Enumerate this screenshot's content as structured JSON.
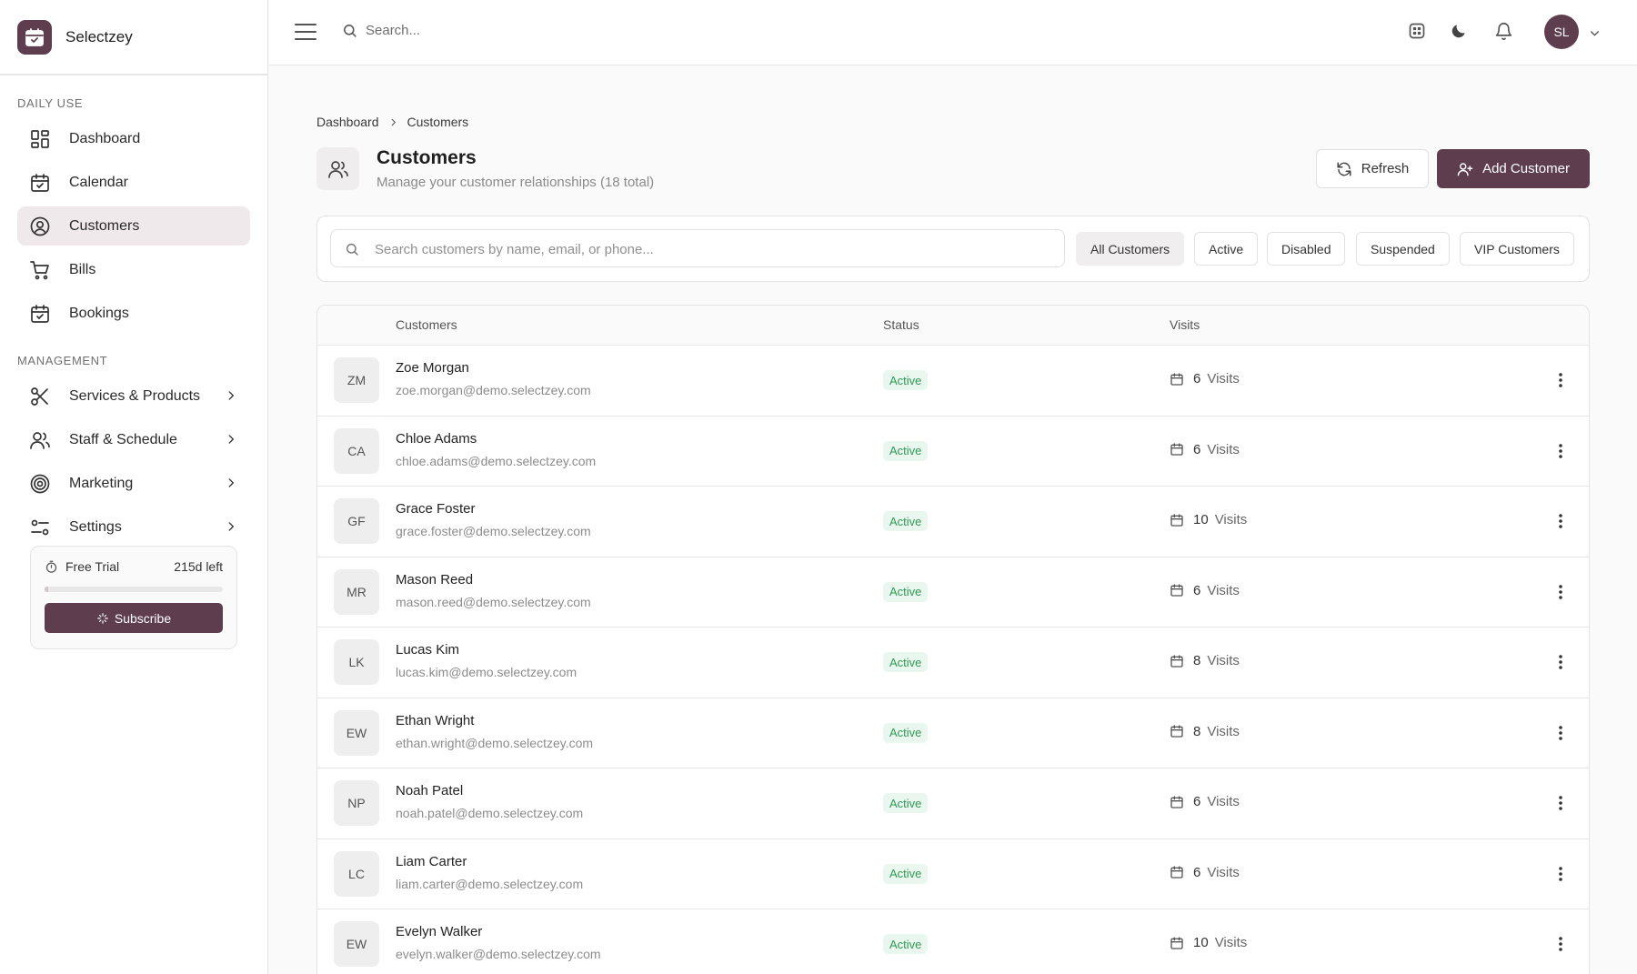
{
  "brand": {
    "name": "Selectzey"
  },
  "sidebar": {
    "daily_label": "DAILY USE",
    "management_label": "MANAGEMENT",
    "items": [
      {
        "label": "Dashboard",
        "icon": "dashboard-icon"
      },
      {
        "label": "Calendar",
        "icon": "calendar-icon"
      },
      {
        "label": "Customers",
        "icon": "customers-icon",
        "active": true
      },
      {
        "label": "Bills",
        "icon": "cart-icon"
      },
      {
        "label": "Bookings",
        "icon": "bookings-icon"
      },
      {
        "label": "Services & Products",
        "icon": "scissors-icon"
      },
      {
        "label": "Staff & Schedule",
        "icon": "staff-icon"
      },
      {
        "label": "Marketing",
        "icon": "target-icon"
      },
      {
        "label": "Settings",
        "icon": "sliders-icon"
      }
    ],
    "trial": {
      "label": "Free Trial",
      "days_left": "215d left",
      "progress": 0.02,
      "subscribe_label": "Subscribe"
    }
  },
  "topbar": {
    "search_placeholder": "Search...",
    "user_initials": "SL"
  },
  "breadcrumb": {
    "root": "Dashboard",
    "current": "Customers"
  },
  "page": {
    "title": "Customers",
    "subtitle": "Manage your customer relationships (18 total)",
    "refresh_label": "Refresh",
    "add_label": "Add Customer"
  },
  "filters": {
    "search_placeholder": "Search customers by name, email, or phone...",
    "chips": [
      "All Customers",
      "Active",
      "Disabled",
      "Suspended",
      "VIP Customers"
    ],
    "active_chip": "All Customers"
  },
  "table": {
    "columns": {
      "customers": "Customers",
      "status": "Status",
      "visits": "Visits"
    },
    "visits_unit": "Visits",
    "rows": [
      {
        "initials": "ZM",
        "name": "Zoe Morgan",
        "email": "zoe.morgan@demo.selectzey.com",
        "status": "Active",
        "visits": "6"
      },
      {
        "initials": "CA",
        "name": "Chloe Adams",
        "email": "chloe.adams@demo.selectzey.com",
        "status": "Active",
        "visits": "6"
      },
      {
        "initials": "GF",
        "name": "Grace Foster",
        "email": "grace.foster@demo.selectzey.com",
        "status": "Active",
        "visits": "10"
      },
      {
        "initials": "MR",
        "name": "Mason Reed",
        "email": "mason.reed@demo.selectzey.com",
        "status": "Active",
        "visits": "6"
      },
      {
        "initials": "LK",
        "name": "Lucas Kim",
        "email": "lucas.kim@demo.selectzey.com",
        "status": "Active",
        "visits": "8"
      },
      {
        "initials": "EW",
        "name": "Ethan Wright",
        "email": "ethan.wright@demo.selectzey.com",
        "status": "Active",
        "visits": "8"
      },
      {
        "initials": "NP",
        "name": "Noah Patel",
        "email": "noah.patel@demo.selectzey.com",
        "status": "Active",
        "visits": "6"
      },
      {
        "initials": "LC",
        "name": "Liam Carter",
        "email": "liam.carter@demo.selectzey.com",
        "status": "Active",
        "visits": "6"
      },
      {
        "initials": "EW",
        "name": "Evelyn Walker",
        "email": "evelyn.walker@demo.selectzey.com",
        "status": "Active",
        "visits": "10"
      }
    ]
  },
  "colors": {
    "brand": "#5e3d4e",
    "active_status_text": "#2f9a57",
    "active_status_bg": "#eaf7ee"
  }
}
